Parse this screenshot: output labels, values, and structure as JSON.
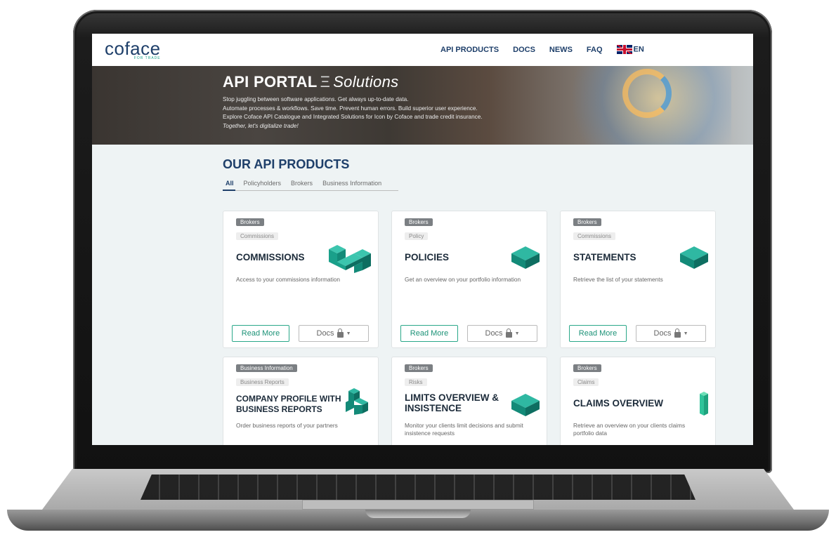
{
  "brand": {
    "logo": "coface",
    "logo_sub": "FOR TRADE"
  },
  "nav": {
    "items": [
      "API PRODUCTS",
      "DOCS",
      "NEWS",
      "FAQ"
    ],
    "language": "EN"
  },
  "hero": {
    "title": "API PORTAL",
    "separator": "Ξ",
    "title_italic": "Solutions",
    "lines": [
      "Stop juggling between software applications. Get always up-to-date data.",
      "Automate processes & workflows. Save time. Prevent human errors. Build superior user experience.",
      "Explore Coface API Catalogue and Integrated Solutions for Icon by Coface and trade credit insurance."
    ],
    "tagline": "Together, let's digitalize trade!"
  },
  "products": {
    "heading": "OUR API PRODUCTS",
    "filters": [
      "All",
      "Policyholders",
      "Brokers",
      "Business Information"
    ],
    "read_more": "Read More",
    "docs": "Docs",
    "cards": [
      {
        "tag": "Brokers",
        "subtag": "Commissions",
        "title_lines": [
          "COMMISSIONS"
        ],
        "desc": "Access to your commissions information",
        "icon": "double-cube-icon"
      },
      {
        "tag": "Brokers",
        "subtag": "Policy",
        "title_lines": [
          "POLICIES"
        ],
        "desc": "Get an overview on your portfolio information",
        "icon": "cube-icon"
      },
      {
        "tag": "Brokers",
        "subtag": "Commissions",
        "title_lines": [
          "STATEMENTS"
        ],
        "desc": "Retrieve the list of your statements",
        "icon": "cube-icon"
      },
      {
        "tag": "Business Information",
        "subtag": "Business Reports",
        "title_lines": [
          "COMPANY PROFILE WITH",
          "BUSINESS REPORTS"
        ],
        "desc": "Order business reports of your partners",
        "icon": "stairs-icon"
      },
      {
        "tag": "Brokers",
        "subtag": "Risks",
        "title_lines": [
          "LIMITS OVERVIEW &",
          "INSISTENCE"
        ],
        "desc": "Monitor your clients limit decisions and submit insistence requests",
        "icon": "cube-icon"
      },
      {
        "tag": "Brokers",
        "subtag": "Claims",
        "title_lines": [
          "CLAIMS OVERVIEW"
        ],
        "desc": "Retrieve an overview on your clients claims portfolio data",
        "icon": "pillar-icon"
      }
    ]
  },
  "colors": {
    "navy": "#1e3f6a",
    "teal": "#2aa889",
    "cube_top": "#2fb8a2",
    "cube_left": "#138a78",
    "cube_right": "#0e6e61"
  }
}
